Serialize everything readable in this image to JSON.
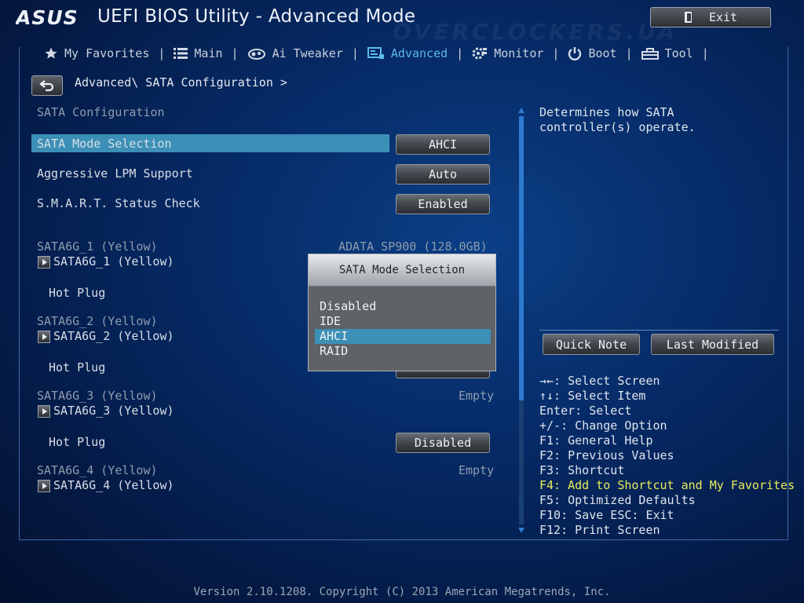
{
  "header": {
    "brand": "ASUS",
    "title": "UEFI BIOS Utility - Advanced Mode",
    "watermark": "OVERCLOCKERS.UA",
    "exit_label": "Exit"
  },
  "tabs": [
    {
      "label": "My Favorites",
      "icon": "star-icon",
      "active": false
    },
    {
      "label": "Main",
      "icon": "list-icon",
      "active": false
    },
    {
      "label": "Ai Tweaker",
      "icon": "tweaker-icon",
      "active": false
    },
    {
      "label": "Advanced",
      "icon": "advanced-icon",
      "active": true
    },
    {
      "label": "Monitor",
      "icon": "monitor-icon",
      "active": false
    },
    {
      "label": "Boot",
      "icon": "power-icon",
      "active": false
    },
    {
      "label": "Tool",
      "icon": "tool-icon",
      "active": false
    }
  ],
  "breadcrumb": "Advanced\\ SATA Configuration >",
  "section_title": "SATA Configuration",
  "settings": {
    "sata_mode": {
      "label": "SATA Mode Selection",
      "value": "AHCI"
    },
    "lpm": {
      "label": "Aggressive LPM Support",
      "value": "Auto"
    },
    "smart": {
      "label": "S.M.A.R.T. Status Check",
      "value": "Enabled"
    }
  },
  "ports": [
    {
      "header": "SATA6G_1 (Yellow)",
      "device": "ADATA SP900    (128.0GB)",
      "submenu": "SATA6G_1 (Yellow)",
      "hotplug_label": "Hot Plug",
      "hotplug_value": ""
    },
    {
      "header": "SATA6G_2 (Yellow)",
      "device": "",
      "submenu": "SATA6G_2 (Yellow)",
      "hotplug_label": "Hot Plug",
      "hotplug_value": ""
    },
    {
      "header": "SATA6G_3 (Yellow)",
      "device": "Empty",
      "submenu": "SATA6G_3 (Yellow)",
      "hotplug_label": "Hot Plug",
      "hotplug_value": "Disabled"
    },
    {
      "header": "SATA6G_4 (Yellow)",
      "device": "Empty",
      "submenu": "SATA6G_4 (Yellow)"
    }
  ],
  "popup": {
    "title": "SATA Mode Selection",
    "options": [
      "Disabled",
      "IDE",
      "AHCI",
      "RAID"
    ],
    "selected": "AHCI"
  },
  "help": {
    "text": "Determines how SATA controller(s) operate."
  },
  "buttons": {
    "quick_note": "Quick Note",
    "last_modified": "Last Modified"
  },
  "keys": [
    "→←: Select Screen",
    "↑↓: Select Item",
    "Enter: Select",
    "+/-: Change Option",
    "F1: General Help",
    "F2: Previous Values",
    "F3: Shortcut",
    "F4: Add to Shortcut and My Favorites",
    "F5: Optimized Defaults",
    "F10: Save  ESC: Exit",
    "F12: Print Screen"
  ],
  "footer": "Version 2.10.1208. Copyright (C) 2013 American Megatrends, Inc.",
  "colors": {
    "highlight": "#3c8fb6",
    "active_tab": "#5bb8ea",
    "key_highlight": "#e8ec5a"
  }
}
